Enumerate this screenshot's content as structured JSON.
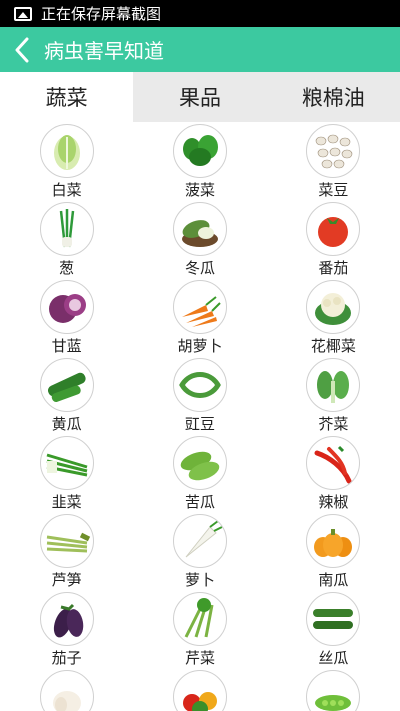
{
  "status_bar": {
    "text": "正在保存屏幕截图"
  },
  "app_bar": {
    "title": "病虫害早知道"
  },
  "tabs": [
    {
      "label": "蔬菜",
      "active": true
    },
    {
      "label": "果品",
      "active": false
    },
    {
      "label": "粮棉油",
      "active": false
    }
  ],
  "vegetables": [
    {
      "label": "白菜",
      "icon": "cabbage-icon"
    },
    {
      "label": "菠菜",
      "icon": "spinach-icon"
    },
    {
      "label": "菜豆",
      "icon": "beans-icon"
    },
    {
      "label": "葱",
      "icon": "scallion-icon"
    },
    {
      "label": "冬瓜",
      "icon": "wax-gourd-icon"
    },
    {
      "label": "番茄",
      "icon": "tomato-icon"
    },
    {
      "label": "甘蓝",
      "icon": "red-cabbage-icon"
    },
    {
      "label": "胡萝卜",
      "icon": "carrot-icon"
    },
    {
      "label": "花椰菜",
      "icon": "cauliflower-icon"
    },
    {
      "label": "黄瓜",
      "icon": "cucumber-icon"
    },
    {
      "label": "豇豆",
      "icon": "cowpea-icon"
    },
    {
      "label": "芥菜",
      "icon": "mustard-greens-icon"
    },
    {
      "label": "韭菜",
      "icon": "chives-icon"
    },
    {
      "label": "苦瓜",
      "icon": "bitter-melon-icon"
    },
    {
      "label": "辣椒",
      "icon": "chili-icon"
    },
    {
      "label": "芦笋",
      "icon": "asparagus-icon"
    },
    {
      "label": "萝卜",
      "icon": "radish-icon"
    },
    {
      "label": "南瓜",
      "icon": "pumpkin-icon"
    },
    {
      "label": "茄子",
      "icon": "eggplant-icon"
    },
    {
      "label": "芹菜",
      "icon": "celery-icon"
    },
    {
      "label": "丝瓜",
      "icon": "loofah-icon"
    },
    {
      "label": "",
      "icon": "garlic-icon"
    },
    {
      "label": "",
      "icon": "bell-pepper-icon"
    },
    {
      "label": "",
      "icon": "pea-icon"
    }
  ]
}
